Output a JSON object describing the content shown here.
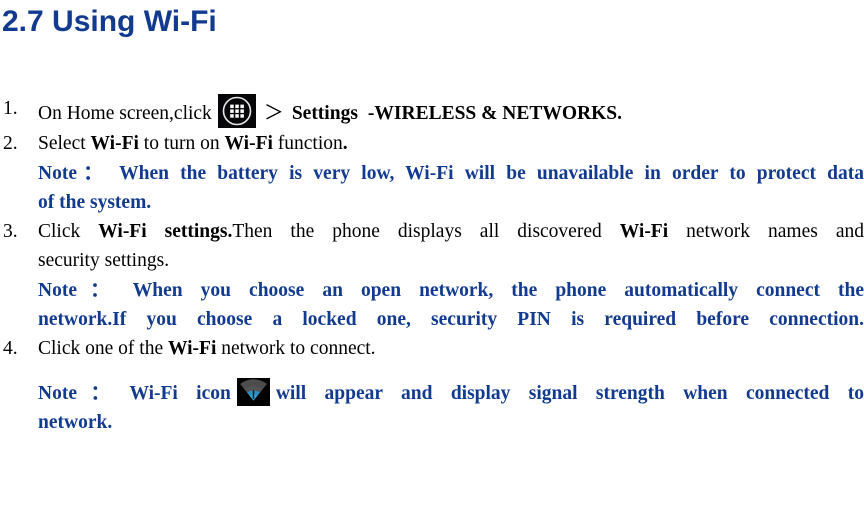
{
  "document": {
    "title": "2.7 Using Wi-Fi",
    "title_color": "#123a8f",
    "note_color": "#123a8f",
    "body_color": "#000000"
  },
  "steps": [
    {
      "number": "1.",
      "pre_icon_text": "On Home screen,click",
      "icon": "app-drawer-icon",
      "separator": "＞",
      "bold_target": "Settings",
      "post_text": "-WIRELESS & NETWORKS."
    },
    {
      "number": "2.",
      "segments": [
        {
          "text": "Select ",
          "bold": false
        },
        {
          "text": "Wi-Fi",
          "bold": true
        },
        {
          "text": " to turn on ",
          "bold": false
        },
        {
          "text": "Wi-Fi",
          "bold": true
        },
        {
          "text": " function",
          "bold": false
        },
        {
          "text": ".",
          "bold": true
        }
      ]
    },
    {
      "number": "3.",
      "line1": [
        {
          "text": "Click ",
          "bold": false
        },
        {
          "text": "Wi-Fi settings.",
          "bold": true
        },
        {
          "text": "Then the phone displays all discovered ",
          "bold": false
        },
        {
          "text": "Wi-Fi",
          "bold": true
        },
        {
          "text": " network names and",
          "bold": false
        }
      ],
      "line2": "security settings."
    },
    {
      "number": "4.",
      "segments": [
        {
          "text": "Click one of the ",
          "bold": false
        },
        {
          "text": "Wi-Fi",
          "bold": true
        },
        {
          "text": " network to connect.",
          "bold": false
        }
      ]
    }
  ],
  "notes": [
    {
      "id": "note-battery",
      "label": "Note：",
      "line1": "When the battery is very low, Wi-Fi will be unavailable in order to protect data",
      "line2": "of the system."
    },
    {
      "id": "note-open-network",
      "label": "Note：",
      "line1": "When you choose an open network, the phone automatically connect the",
      "line2": "network.If you choose a locked one, security PIN is required before connection."
    },
    {
      "id": "note-wifi-icon",
      "label": "Note：",
      "pre_icon_text": "Wi-Fi icon",
      "icon": "wifi-signal-icon",
      "post_icon_text": "will appear and display signal strength when connected to",
      "line2": "network."
    }
  ],
  "icons": {
    "app_drawer": {
      "name": "app-drawer-icon",
      "background": "#060608",
      "foreground": "#ffffff"
    },
    "wifi_signal": {
      "name": "wifi-signal-icon",
      "background": "#010101",
      "inactive": "#5a5a5a",
      "active": "#2a8fc4"
    }
  }
}
